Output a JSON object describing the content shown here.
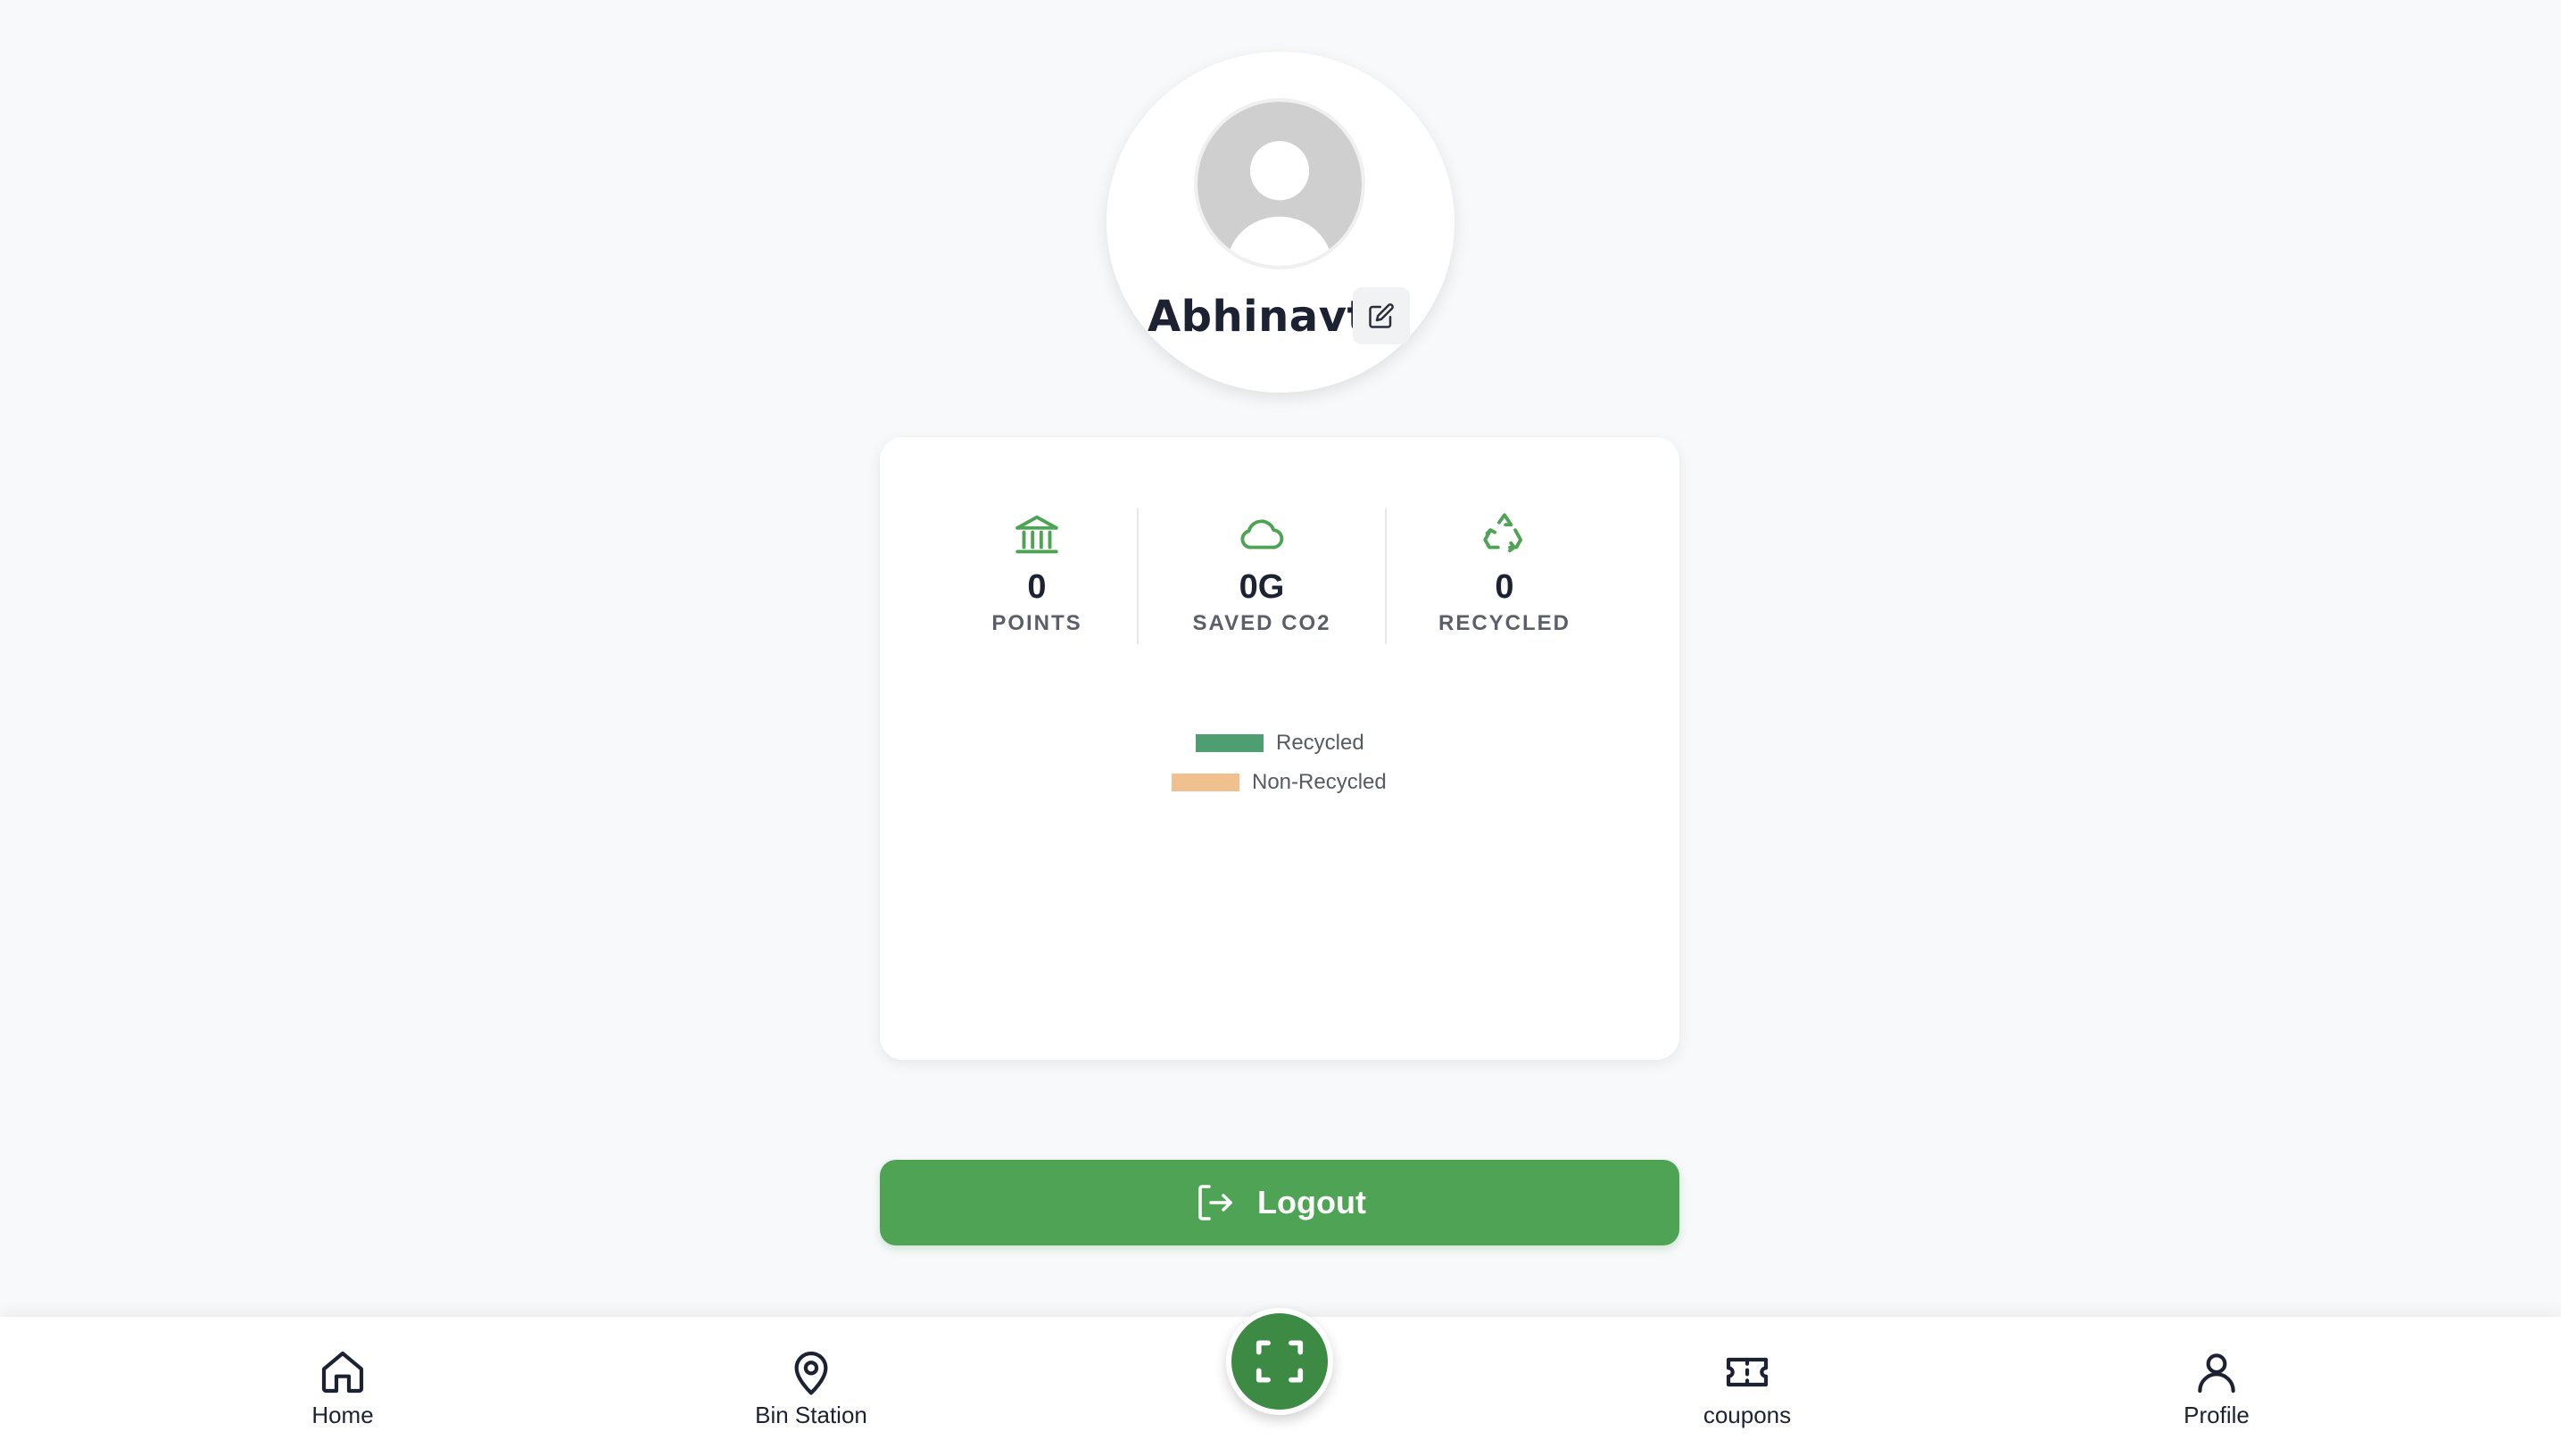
{
  "profile": {
    "username": "Abhinavt",
    "edit_icon": "pencil-square-icon",
    "avatar_icon": "default-user-avatar"
  },
  "stats": [
    {
      "icon": "bank-icon",
      "value": "0",
      "label": "POINTS"
    },
    {
      "icon": "cloud-icon",
      "value": "0G",
      "label": "SAVED CO2"
    },
    {
      "icon": "recycle-icon",
      "value": "0",
      "label": "RECYCLED"
    }
  ],
  "chart_data": {
    "type": "pie",
    "series": [
      {
        "name": "Recycled",
        "value": 0,
        "color": "#4f9e72"
      },
      {
        "name": "Non-Recycled",
        "value": 0,
        "color": "#f0c18e"
      }
    ],
    "legend_position": "top-center"
  },
  "logout": {
    "label": "Logout",
    "icon": "logout-icon"
  },
  "nav": {
    "items": [
      {
        "label": "Home",
        "icon": "home-icon"
      },
      {
        "label": "Bin Station",
        "icon": "map-pin-icon"
      },
      {
        "label": "coupons",
        "icon": "ticket-icon"
      },
      {
        "label": "Profile",
        "icon": "user-icon"
      }
    ],
    "scan_icon": "scan-frame-icon"
  },
  "colors": {
    "accent": "#4ea354",
    "scan_button": "#3d8a45",
    "background": "#f8f9fb"
  }
}
